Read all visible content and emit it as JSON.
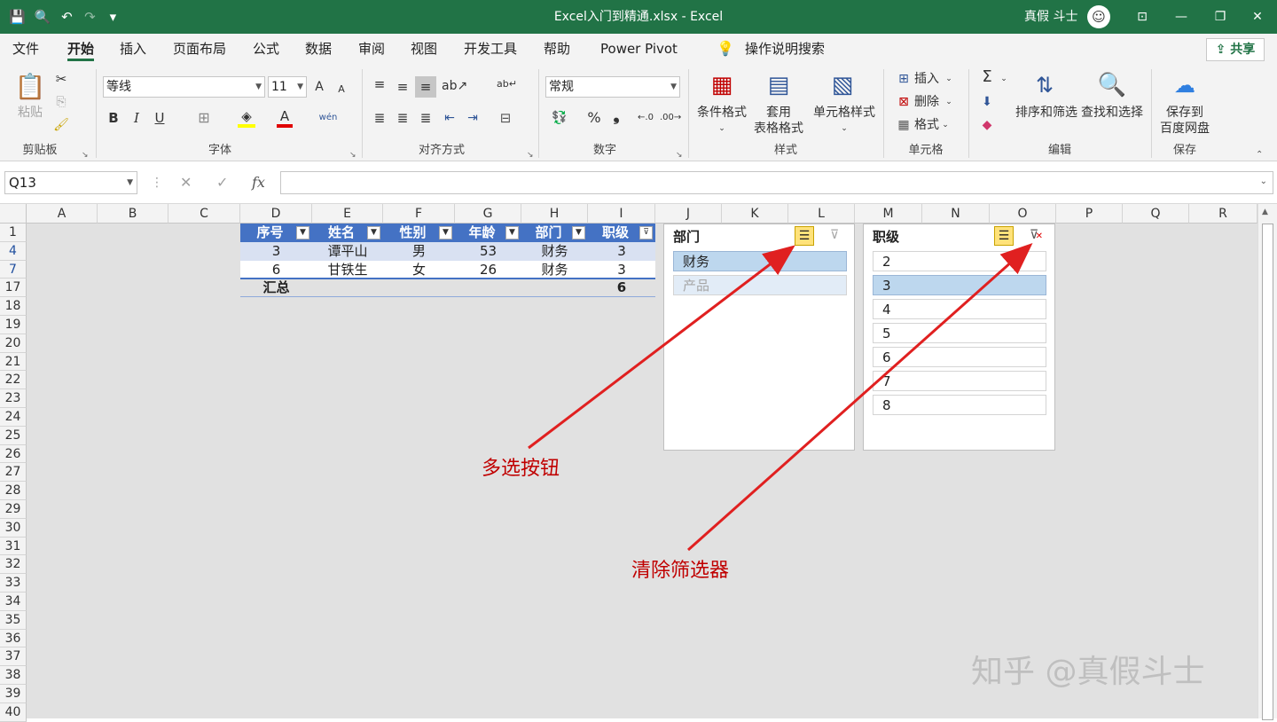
{
  "titlebar": {
    "save": "💾",
    "preview": "🔍",
    "undo": "↶",
    "redo": "↷",
    "customize": "▾",
    "title": "Excel入门到精通.xlsx  -  Excel",
    "user": "真假 斗士",
    "avatar": "☺",
    "ribbon_options": "⊡",
    "minimize": "—",
    "restore": "❐",
    "close": "✕"
  },
  "menu": {
    "items": [
      "文件",
      "开始",
      "插入",
      "页面布局",
      "公式",
      "数据",
      "审阅",
      "视图",
      "开发工具",
      "帮助",
      "Power Pivot"
    ],
    "active": "开始",
    "tell_me": "操作说明搜索",
    "share": "共享"
  },
  "ribbon": {
    "clipboard": {
      "paste": "粘贴",
      "label": "剪贴板"
    },
    "font": {
      "name": "等线",
      "size": "11",
      "grow": "A",
      "shrink": "A",
      "bold": "B",
      "italic": "I",
      "underline": "U",
      "phonetic": "wén",
      "label": "字体"
    },
    "alignment": {
      "label": "对齐方式"
    },
    "number": {
      "format": "常规",
      "percent": "%",
      "comma": "❟",
      "label": "数字"
    },
    "styles": {
      "conditional": "条件格式",
      "table_l1": "套用",
      "table_l2": "表格格式",
      "cell_styles": "单元格样式",
      "label": "样式"
    },
    "cells": {
      "insert": "插入",
      "delete": "删除",
      "format": "格式",
      "label": "单元格"
    },
    "editing": {
      "sum": "Σ",
      "sort": "排序和筛选",
      "find": "查找和选择",
      "label": "编辑"
    },
    "save": {
      "l1": "保存到",
      "l2": "百度网盘",
      "label": "保存"
    }
  },
  "formula_bar": {
    "name_box": "Q13",
    "fx": "fx",
    "cancel": "✕",
    "enter": "✓",
    "value": ""
  },
  "columns": [
    "A",
    "B",
    "C",
    "D",
    "E",
    "F",
    "G",
    "H",
    "I",
    "J",
    "K",
    "L",
    "M",
    "N",
    "O",
    "P",
    "Q",
    "R"
  ],
  "rows": [
    "1",
    "4",
    "7",
    "17",
    "18",
    "19",
    "20",
    "21",
    "22",
    "23",
    "24",
    "25",
    "26",
    "27",
    "28",
    "29",
    "30",
    "31",
    "32",
    "33",
    "34",
    "35",
    "36",
    "37",
    "38",
    "39",
    "40"
  ],
  "table": {
    "headers": [
      "序号",
      "姓名",
      "性别",
      "年龄",
      "部门",
      "职级"
    ],
    "data": [
      [
        "3",
        "谭平山",
        "男",
        "53",
        "财务",
        "3"
      ],
      [
        "6",
        "甘铁生",
        "女",
        "26",
        "财务",
        "3"
      ]
    ],
    "total_label": "汇总",
    "total_value": "6"
  },
  "slicer_dept": {
    "title": "部门",
    "items": [
      {
        "label": "财务",
        "state": "selected"
      },
      {
        "label": "产品",
        "state": "nodata"
      }
    ]
  },
  "slicer_level": {
    "title": "职级",
    "items": [
      {
        "label": "2",
        "state": "normal"
      },
      {
        "label": "3",
        "state": "selected"
      },
      {
        "label": "4",
        "state": "normal"
      },
      {
        "label": "5",
        "state": "normal"
      },
      {
        "label": "6",
        "state": "normal"
      },
      {
        "label": "7",
        "state": "normal"
      },
      {
        "label": "8",
        "state": "normal"
      }
    ]
  },
  "annotations": {
    "multi_select": "多选按钮",
    "clear_filter": "清除筛选器"
  },
  "watermark": "知乎 @真假斗士",
  "colors": {
    "excel_green": "#217346",
    "table_header": "#4472c4",
    "table_band": "#d9e1f2",
    "slicer_selected": "#bdd7ee",
    "annotation": "#c00000"
  }
}
